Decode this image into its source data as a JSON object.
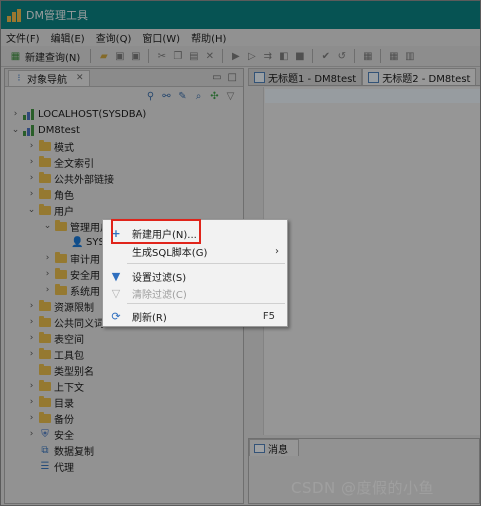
{
  "window": {
    "title": "DM管理工具"
  },
  "menubar": [
    "文件(F)",
    "编辑(E)",
    "查询(Q)",
    "窗口(W)",
    "帮助(H)"
  ],
  "toolbar": {
    "new_query_label": "新建查询(N)"
  },
  "left_pane": {
    "tab_label": "对象导航",
    "tree": [
      {
        "label": "LOCALHOST(SYSDBA)",
        "icon": "db-icon",
        "expanded": false
      },
      {
        "label": "DM8test",
        "icon": "db-icon",
        "expanded": true
      },
      {
        "label": "模式",
        "icon": "folder-icon"
      },
      {
        "label": "全文索引",
        "icon": "folder-icon"
      },
      {
        "label": "公共外部链接",
        "icon": "folder-icon"
      },
      {
        "label": "角色",
        "icon": "folder-icon"
      },
      {
        "label": "用户",
        "icon": "folder-icon",
        "expanded": true
      },
      {
        "label": "管理用户",
        "icon": "folder-open-icon",
        "expanded": true
      },
      {
        "label": "SYS",
        "icon": "user-icon"
      },
      {
        "label": "审计用",
        "icon": "folder-icon"
      },
      {
        "label": "安全用",
        "icon": "folder-icon"
      },
      {
        "label": "系统用",
        "icon": "folder-icon"
      },
      {
        "label": "资源限制",
        "icon": "folder-icon"
      },
      {
        "label": "公共同义词",
        "icon": "folder-icon"
      },
      {
        "label": "表空间",
        "icon": "folder-icon"
      },
      {
        "label": "工具包",
        "icon": "folder-icon"
      },
      {
        "label": "类型别名",
        "icon": "folder-icon"
      },
      {
        "label": "上下文",
        "icon": "folder-icon"
      },
      {
        "label": "目录",
        "icon": "folder-icon"
      },
      {
        "label": "备份",
        "icon": "folder-icon"
      },
      {
        "label": "安全",
        "icon": "shield-icon"
      },
      {
        "label": "数据复制",
        "icon": "replication-icon"
      },
      {
        "label": "代理",
        "icon": "agent-icon"
      }
    ]
  },
  "editor_tabs": [
    "无标题1 - DM8test",
    "无标题2 - DM8test"
  ],
  "messages_tab": "消息",
  "context_menu": {
    "items": [
      {
        "label": "新建用户(N)...",
        "icon": "plus-icon"
      },
      {
        "label": "生成SQL脚本(G)",
        "submenu": true
      },
      {
        "label": "设置过滤(S)",
        "icon": "filter-icon"
      },
      {
        "label": "清除过滤(C)",
        "icon": "clear-filter-icon",
        "disabled": true
      },
      {
        "label": "刷新(R)",
        "icon": "refresh-icon",
        "shortcut": "F5"
      }
    ]
  },
  "watermark": "CSDN @度假的小鱼"
}
